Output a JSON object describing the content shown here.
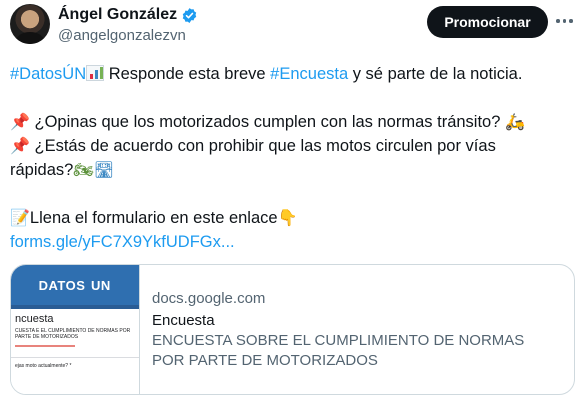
{
  "author": {
    "name": "Ángel González",
    "handle": "@angelgonzalezvn"
  },
  "header": {
    "promote_label": "Promocionar"
  },
  "tweet": {
    "line1_hashtag1": "#DatosÚN",
    "line1_text": " Responde esta breve ",
    "line1_hashtag2": "#Encuesta",
    "line1_text_end": " y sé parte de la noticia.",
    "line2_text": " ¿Opinas que los motorizados cumplen con las normas tránsito? ",
    "line3_text": " ¿Estás de acuerdo con prohibir que las motos circulen por vías",
    "line4_text": "rápidas?",
    "line5_text": "Llena el formulario en este enlace",
    "link": "forms.gle/yFC7X9YkfUDFGx..."
  },
  "card": {
    "thumb_banner": "DATOS",
    "thumb_title": "ncuesta",
    "thumb_sub": "CUESTA\nE EL CUMPLIMIENTO DE NORMAS POR PARTE DE MOTORIZADOS",
    "thumb_q": "ejas moto actualmente? *",
    "domain": "docs.google.com",
    "title": "Encuesta",
    "description": "ENCUESTA SOBRE EL CUMPLIMIENTO DE NORMAS POR PARTE DE MOTORIZADOS"
  },
  "icons": {
    "verified": "verified-badge-icon",
    "more": "more-options-icon",
    "chart": "bar-chart-emoji",
    "pin": "pushpin-emoji",
    "scooter": "scooter-emoji",
    "motorcycle": "motorcycle-emoji",
    "road": "motorway-emoji",
    "memo": "memo-emoji",
    "point_down": "point-down-emoji"
  },
  "colors": {
    "link": "#1d9bf0",
    "verified": "#1d9bf0",
    "promote_bg": "#0f1419",
    "banner": "#2f6fb0"
  }
}
